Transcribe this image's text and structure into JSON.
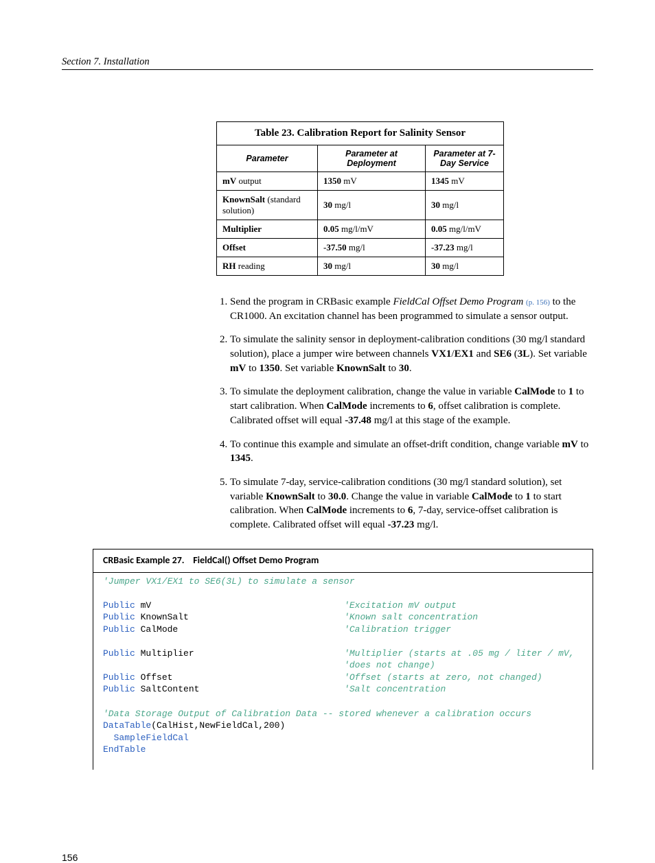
{
  "header": {
    "section": "Section 7.  Installation"
  },
  "table": {
    "caption": "Table 23. Calibration Report for Salinity Sensor",
    "columns": [
      "Parameter",
      "Parameter at Deployment",
      "Parameter at 7-Day Service"
    ],
    "rows": [
      {
        "p_bold": "mV",
        "p_rest": " output",
        "dep_b": "1350",
        "dep_r": " mV",
        "svc_b": "1345",
        "svc_r": " mV"
      },
      {
        "p_bold": "KnownSalt",
        "p_rest": " (standard solution)",
        "dep_b": "30",
        "dep_r": " mg/l",
        "svc_b": "30",
        "svc_r": " mg/l"
      },
      {
        "p_bold": "Multiplier",
        "p_rest": "",
        "dep_b": "0.05",
        "dep_r": " mg/l/mV",
        "svc_b": "0.05",
        "svc_r": " mg/l/mV"
      },
      {
        "p_bold": "Offset",
        "p_rest": "",
        "dep_b": "-37.50",
        "dep_r": " mg/l",
        "svc_b": "-37.23",
        "svc_r": " mg/l"
      },
      {
        "p_bold": "RH",
        "p_rest": " reading",
        "dep_b": "30",
        "dep_r": " mg/l",
        "svc_b": "30",
        "svc_r": " mg/l"
      }
    ]
  },
  "steps": {
    "s1a": "Send the program in CRBasic example ",
    "s1_i": "FieldCal Offset Demo Program ",
    "s1_ref": "(p. 156)",
    "s1b": " to the CR1000.  An excitation channel has been programmed to simulate a sensor output.",
    "s2": "To simulate the salinity sensor in deployment-calibration conditions (30 mg/l standard solution), place a jumper wire between channels ",
    "s2_b1": "VX1",
    "s2_m1": "/",
    "s2_b2": "EX1",
    "s2_m2": " and ",
    "s2_b3": "SE6",
    "s2_m3": " (",
    "s2_b4": "3L",
    "s2_m4": "). Set variable ",
    "s2_b5": "mV",
    "s2_m5": " to ",
    "s2_b6": "1350",
    "s2_m6": ". Set variable ",
    "s2_b7": "KnownSalt",
    "s2_m7": " to ",
    "s2_b8": "30",
    "s2_m8": ".",
    "s3a": "To simulate the deployment calibration, change the value in variable ",
    "s3_b1": "CalMode",
    "s3b": " to ",
    "s3_b2": "1",
    "s3c": " to start calibration. When ",
    "s3_b3": "CalMode",
    "s3d": " increments to ",
    "s3_b4": "6",
    "s3e": ", offset calibration is complete. Calibrated offset will equal ",
    "s3_b5": "-37.48",
    "s3f": " mg/l at this stage of the example.",
    "s4a": "To continue this example and simulate an offset-drift condition, change variable ",
    "s4_b1": "mV",
    "s4b": " to ",
    "s4_b2": "1345",
    "s4c": ".",
    "s5a": "To simulate 7-day, service-calibration conditions (30 mg/l standard solution), set variable ",
    "s5_b1": "KnownSalt",
    "s5b": " to ",
    "s5_b2": "30.0",
    "s5c": ". Change the value in variable ",
    "s5_b3": "CalMode",
    "s5d": " to ",
    "s5_b4": "1",
    "s5e": " to start calibration. When ",
    "s5_b5": "CalMode",
    "s5f": " increments to ",
    "s5_b6": "6",
    "s5g": ", 7-day, service-offset calibration is complete. Calibrated offset will equal ",
    "s5_b7": "-37.23",
    "s5h": " mg/l."
  },
  "code": {
    "title_a": "CRBasic Example 27.",
    "title_b": "FieldCal() Offset Demo Program",
    "c1": "'Jumper VX1/EX1 to SE6(3L) to simulate a sensor",
    "kw_public": "Public",
    "v_mv": " mV",
    "v_ks": " KnownSalt",
    "v_cm": " CalMode",
    "v_mu": " Multiplier",
    "v_of": " Offset",
    "v_sc": " SaltContent",
    "c_mv": "'Excitation mV output",
    "c_ks": "'Known salt concentration",
    "c_cm": "'Calibration trigger",
    "c_mu": "'Multiplier (starts at .05 mg / liter / mV,",
    "c_mu2": "'does not change)",
    "c_of": "'Offset (starts at zero, not changed)",
    "c_sc": "'Salt concentration",
    "c_ds": "'Data Storage Output of Calibration Data -- stored whenever a calibration occurs",
    "kw_dt": "DataTable",
    "dt_args": "(CalHist,NewFieldCal,200)",
    "kw_sf": "SampleFieldCal",
    "kw_et": "EndTable"
  },
  "footer": {
    "page": "156"
  }
}
